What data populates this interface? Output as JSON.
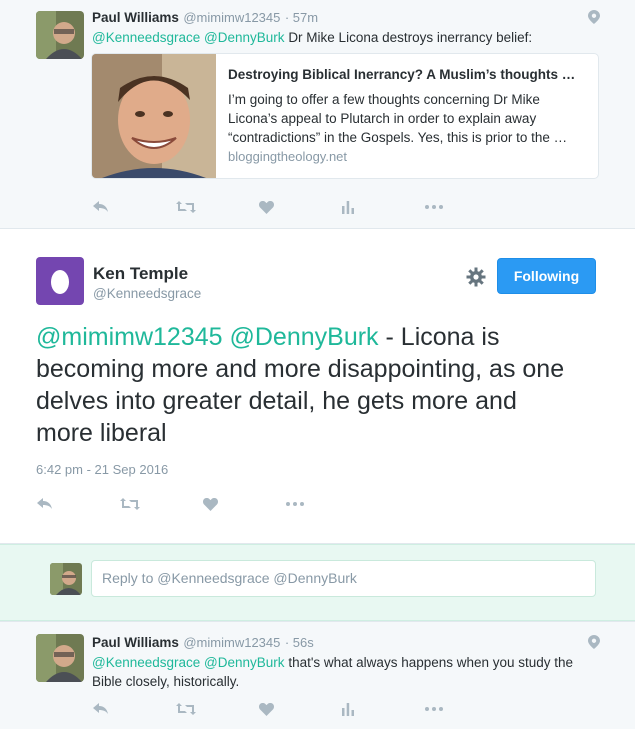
{
  "reply_tweet_top": {
    "name": "Paul Williams",
    "handle": "@mimimw12345",
    "time": "· 57m",
    "mention1": "@Kenneedsgrace",
    "mention2": "@DennyBurk",
    "text": "Dr Mike Licona destroys inerrancy belief:",
    "card": {
      "title": "Destroying Biblical Inerrancy? A Muslim’s thoughts …",
      "description": "I’m going to offer a few thoughts concerning Dr Mike Licona’s appeal to Plutarch in order to explain away “contradictions” in the Gospels. Yes, this is prior to the …",
      "domain": "bloggingtheology.net"
    }
  },
  "main_tweet": {
    "name": "Ken Temple",
    "handle": "@Kenneedsgrace",
    "follow_label": "Following",
    "mention1": "@mimimw12345",
    "mention2": "@DennyBurk",
    "text": " - Licona is becoming more and more disappointing, as one delves into greater detail, he gets more and more liberal",
    "timestamp": "6:42 pm - 21 Sep 2016"
  },
  "reply_box": {
    "placeholder": "Reply to @Kenneedsgrace @DennyBurk"
  },
  "reply_tweet_bottom": {
    "name": "Paul Williams",
    "handle": "@mimimw12345",
    "time": "· 56s",
    "mention1": "@Kenneedsgrace",
    "mention2": "@DennyBurk",
    "text": "that's what always happens when you study the Bible closely, historically."
  },
  "colors": {
    "accent": "#1da1f2",
    "mention_green": "#1fb89a",
    "follow_button": "#2b9af3",
    "egg_avatar": "#7446b0",
    "muted": "#8899a6"
  },
  "icons": [
    "reply-icon",
    "retweet-icon",
    "like-icon",
    "analytics-icon",
    "more-icon",
    "location-pin-icon",
    "gear-icon",
    "egg-avatar-icon"
  ]
}
